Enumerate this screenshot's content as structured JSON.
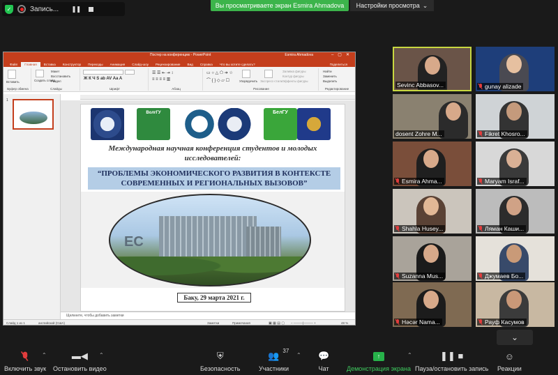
{
  "top_bar": {
    "recording_label": "Запись...",
    "share_banner": "Вы просматриваете экран Esmira Ahmadova",
    "view_settings": "Настройки просмотра"
  },
  "powerpoint": {
    "window_title": "Постер на конференцию - PowerPoint",
    "user": "Esmira Ahmadova",
    "tabs": [
      "Файл",
      "Главная",
      "Вставка",
      "Конструктор",
      "Переходы",
      "Анимация",
      "Слайд-шоу",
      "Рецензирование",
      "Вид",
      "Справка",
      "Что вы хотите сделать?"
    ],
    "share_btn": "Поделиться",
    "ribbon": {
      "paste": "Вставить",
      "clipboard": "Буфер обмена",
      "create_slide": "Создать слайд",
      "layout": "Макет",
      "reset": "Восстановить",
      "section": "Раздел",
      "slides": "Слайды",
      "font": "Шрифт",
      "paragraph": "Абзац",
      "arrange": "Упорядочить",
      "express_styles": "Экспресс-стили",
      "drawing": "Рисование",
      "find": "Найти",
      "replace": "Заменить",
      "select": "Выделить",
      "editing": "Редактирование",
      "shape_fill": "Заливка фигуры",
      "shape_outline": "Контур фигуры",
      "shape_effects": "Эффекты фигуры"
    },
    "slide_number": "1",
    "slide": {
      "conference": "Международная научная конференция студентов и молодых исследователей:",
      "title": "“ПРОБЛЕМЫ ЭКОНОМИЧЕСКОГО РАЗВИТИЯ В КОНТЕКСТЕ СОВРЕМЕННЫХ И РЕГИОНАЛЬНЫХ ВЫЗОВОВ”",
      "photo_sign": "EC",
      "logo_text_2": "ВолгГУ",
      "logo_text_5": "БелГУ",
      "date": "Баку, 29 марта 2021 г."
    },
    "notes_placeholder": "Щелкните, чтобы добавить заметки",
    "status": {
      "slide_count": "Слайд 1 из 1",
      "language": "английский (США)",
      "notes": "Заметки",
      "comments": "Примечания",
      "zoom": "48 %"
    }
  },
  "participants": [
    {
      "name": "Sevinc Abbasov...",
      "muted": false,
      "speaking": true
    },
    {
      "name": "gunay alizade",
      "muted": true,
      "speaking": false
    },
    {
      "name": "dosent Zohre M...",
      "muted": false,
      "speaking": false
    },
    {
      "name": "Fikret Khosro...",
      "muted": true,
      "speaking": false
    },
    {
      "name": "Esmira Ahma...",
      "muted": true,
      "speaking": false
    },
    {
      "name": "Maryam Israf...",
      "muted": true,
      "speaking": false
    },
    {
      "name": "Shahla Husey...",
      "muted": true,
      "speaking": false
    },
    {
      "name": "Ляман Каши...",
      "muted": true,
      "speaking": false
    },
    {
      "name": "Suzanna Mus...",
      "muted": true,
      "speaking": false
    },
    {
      "name": "Джумаев Бо...",
      "muted": true,
      "speaking": false
    },
    {
      "name": "Həcər Nama...",
      "muted": true,
      "speaking": false
    },
    {
      "name": "Рауф Касумов",
      "muted": true,
      "speaking": false
    }
  ],
  "toolbar": {
    "unmute": "Включить звук",
    "start_video": "Остановить видео",
    "security": "Безопасность",
    "participants": "Участники",
    "participants_count": "37",
    "chat": "Чат",
    "share_screen": "Демонстрация экрана",
    "pause_recording": "Пауза/остановить запись",
    "reactions": "Реакции"
  },
  "colors": {
    "ppt_accent": "#c43e1c",
    "share_green": "#3cb44b",
    "speaker_border": "#c8d840",
    "muted_red": "#e23d3d"
  }
}
